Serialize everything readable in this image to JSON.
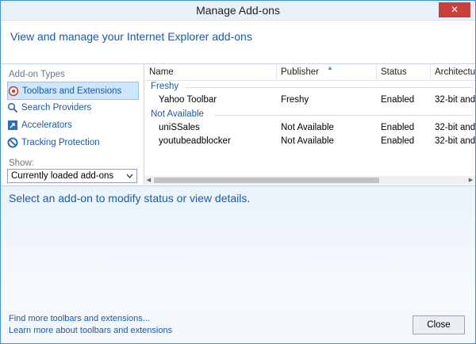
{
  "window": {
    "title": "Manage Add-ons",
    "close_glyph": "✕"
  },
  "header": {
    "title": "View and manage your Internet Explorer add-ons"
  },
  "sidebar": {
    "section_label": "Add-on Types",
    "items": [
      {
        "label": "Toolbars and Extensions",
        "icon": "toolbars-icon",
        "selected": true
      },
      {
        "label": "Search Providers",
        "icon": "search-icon",
        "selected": false
      },
      {
        "label": "Accelerators",
        "icon": "accelerators-icon",
        "selected": false
      },
      {
        "label": "Tracking Protection",
        "icon": "tracking-protection-icon",
        "selected": false
      }
    ],
    "show_label": "Show:",
    "show_selected": "Currently loaded add-ons"
  },
  "table": {
    "columns": [
      "Name",
      "Publisher",
      "Status",
      "Architectur"
    ],
    "groups": [
      {
        "name": "Freshy",
        "rows": [
          {
            "name": "Yahoo Toolbar",
            "publisher": "Freshy",
            "status": "Enabled",
            "arch": "32-bit and"
          }
        ]
      },
      {
        "name": "Not Available",
        "rows": [
          {
            "name": "uniSSales",
            "publisher": "Not Available",
            "status": "Enabled",
            "arch": "32-bit and"
          },
          {
            "name": "youtubeadblocker",
            "publisher": "Not Available",
            "status": "Enabled",
            "arch": "32-bit and"
          }
        ]
      }
    ]
  },
  "details": {
    "message": "Select an add-on to modify status or view details."
  },
  "footer": {
    "link1": "Find more toolbars and extensions...",
    "link2": "Learn more about toolbars and extensions",
    "close_label": "Close"
  }
}
